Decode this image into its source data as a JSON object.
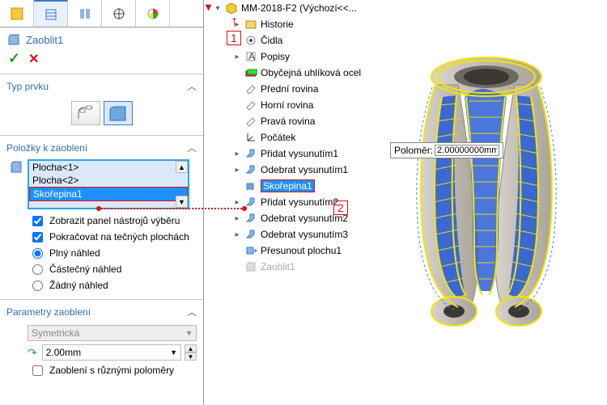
{
  "tabs": {
    "count": 5
  },
  "feature": {
    "title": "Zaoblit1",
    "ok": "✓",
    "cancel": "✕"
  },
  "sections": {
    "type_label": "Typ prvku",
    "items_label": "Položky k zaoblení",
    "params_label": "Parametry zaoblení"
  },
  "selection_list": {
    "items": [
      "Plocha<1>",
      "Plocha<2>",
      "Skořepina1"
    ],
    "highlighted_index": 2
  },
  "options": {
    "show_toolbar": {
      "label": "Zobrazit panel nástrojů výběru",
      "checked": true
    },
    "tangent": {
      "label": "Pokračovat na tečných plochách",
      "checked": true
    },
    "preview_full": {
      "label": "Plný náhled",
      "selected": true
    },
    "preview_partial": {
      "label": "Částečný náhled",
      "selected": false
    },
    "preview_none": {
      "label": "Žádný náhled",
      "selected": false
    }
  },
  "params": {
    "symmetry": "Symetrická",
    "radius_value": "2.00mm",
    "multi_radius": {
      "label": "Zaoblení s různými poloměry",
      "checked": false
    }
  },
  "tree": {
    "root": "MM-2018-F2  (Výchozí<<...",
    "nodes": [
      {
        "label": "Historie",
        "expandable": true
      },
      {
        "label": "Čidla"
      },
      {
        "label": "Popisy",
        "expandable": true
      },
      {
        "label": "Obyčejná uhlíková ocel"
      },
      {
        "label": "Přední rovina"
      },
      {
        "label": "Horní rovina"
      },
      {
        "label": "Pravá rovina"
      },
      {
        "label": "Počátek"
      },
      {
        "label": "Přidat vysunutím1",
        "expandable": true
      },
      {
        "label": "Odebrat vysunutím1",
        "expandable": true
      },
      {
        "label": "Skořepina1",
        "highlight": true
      },
      {
        "label": "Přidat vysunutím2",
        "expandable": true
      },
      {
        "label": "Odebrat vysunutím2",
        "expandable": true
      },
      {
        "label": "Odebrat vysunutím3",
        "expandable": true
      },
      {
        "label": "Přesunout plochu1"
      },
      {
        "label": "Zaoblit1",
        "grey": true
      }
    ]
  },
  "callouts": {
    "n1": "1",
    "n2": "2"
  },
  "tooltip": {
    "label": "Poloměr:",
    "value": "2.00000000mm"
  },
  "colors": {
    "brand_blue": "#1e90ff",
    "highlight_red": "#d11",
    "mesh_yellow": "#f5e400",
    "part_fill": "#2b5fd6",
    "part_grey": "#c8c3bd"
  }
}
